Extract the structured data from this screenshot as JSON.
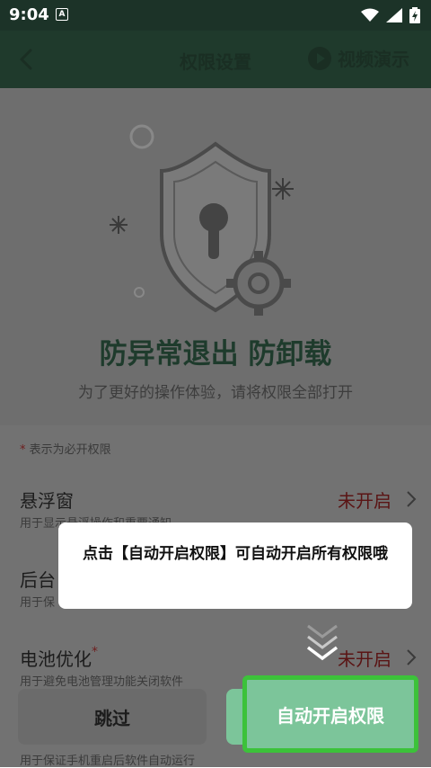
{
  "status_bar": {
    "time": "9:04",
    "notification_icon": "A"
  },
  "app_bar": {
    "title": "权限设置",
    "video_demo_label": "视频演示"
  },
  "hero": {
    "title": "防异常退出 防卸载",
    "subtitle": "为了更好的操作体验，请将权限全部打开"
  },
  "required_note": {
    "star": "*",
    "text": " 表示为必开权限"
  },
  "permissions": [
    {
      "name": "悬浮窗",
      "required": false,
      "status": "未开启",
      "desc": "用于显示悬浮操作和重要通知"
    },
    {
      "name": "后台",
      "required": false,
      "status": "",
      "desc": "用于保"
    },
    {
      "name": "电池优化",
      "required": true,
      "star": "*",
      "status": "未开启",
      "desc": "用于避免电池管理功能关闭软件"
    }
  ],
  "footer_partial_text": "用于保证手机重启后软件自动运行",
  "tooltip": {
    "text": "点击【自动开启权限】可自动开启所有权限哦"
  },
  "buttons": {
    "skip": "跳过",
    "auto_enable": "自动开启权限"
  },
  "colors": {
    "accent_green": "#3cc23a",
    "button_green": "#7cc59a",
    "status_red": "#5a1414",
    "app_bar": "#1f3a2c"
  }
}
